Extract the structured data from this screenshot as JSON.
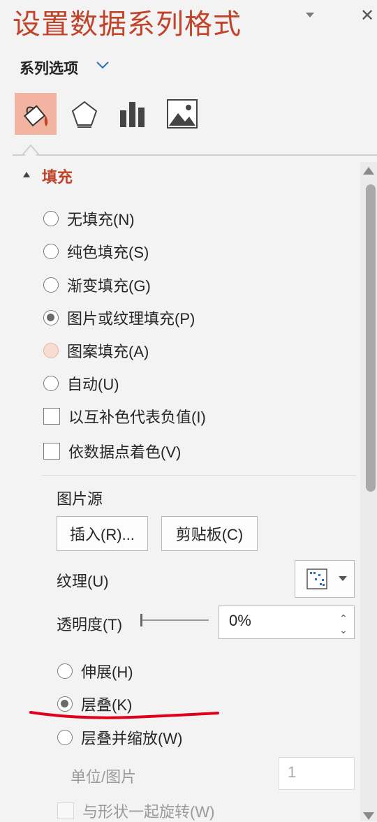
{
  "pane": {
    "title": "设置数据系列格式",
    "options_label": "系列选项",
    "tabs": [
      {
        "icon": "fill-line-icon",
        "active": true
      },
      {
        "icon": "effects-pentagon-icon",
        "active": false
      },
      {
        "icon": "series-options-bar-chart-icon",
        "active": false
      },
      {
        "icon": "picture-icon",
        "active": false
      }
    ]
  },
  "fill": {
    "section_title": "填充",
    "options": [
      {
        "label": "无填充(N)",
        "type": "radio",
        "state": "unchecked"
      },
      {
        "label": "纯色填充(S)",
        "type": "radio",
        "state": "unchecked"
      },
      {
        "label": "渐变填充(G)",
        "type": "radio",
        "state": "unchecked"
      },
      {
        "label": "图片或纹理填充(P)",
        "type": "radio",
        "state": "checked"
      },
      {
        "label": "图案填充(A)",
        "type": "radio",
        "state": "hover"
      },
      {
        "label": "自动(U)",
        "type": "radio",
        "state": "unchecked"
      },
      {
        "label": "以互补色代表负值(I)",
        "type": "checkbox",
        "state": "unchecked"
      },
      {
        "label": "依数据点着色(V)",
        "type": "checkbox",
        "state": "unchecked"
      }
    ],
    "picture_source_label": "图片源",
    "insert_button": "插入(R)...",
    "clipboard_button": "剪贴板(C)",
    "texture_label": "纹理(U)",
    "transparency_label": "透明度(T)",
    "transparency_value": "0%",
    "transparency_level": 0,
    "tiling": [
      {
        "label": "伸展(H)",
        "state": "unchecked"
      },
      {
        "label": "层叠(K)",
        "state": "checked"
      },
      {
        "label": "层叠并缩放(W)",
        "state": "unchecked"
      }
    ],
    "unit_label": "单位/图片",
    "unit_value": "1",
    "rotate_label": "与形状一起旋转(W)"
  },
  "colors": {
    "accent": "#c0432a",
    "active_tab": "#f2b3a0",
    "annotation": "#e0001b"
  }
}
